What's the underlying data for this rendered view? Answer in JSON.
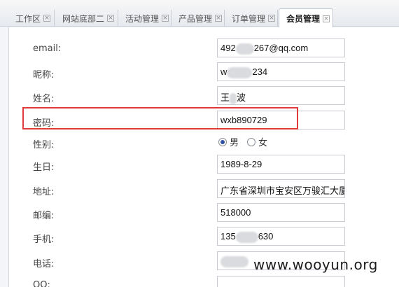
{
  "tabs": [
    {
      "label": "工作区"
    },
    {
      "label": "网站底部二"
    },
    {
      "label": "活动管理"
    },
    {
      "label": "产品管理"
    },
    {
      "label": "订单管理"
    },
    {
      "label": "会员管理"
    }
  ],
  "form": {
    "email_label": "email:",
    "email_prefix": "492",
    "email_suffix": "267@qq.com",
    "nickname_label": "昵称:",
    "nickname_prefix": "w",
    "nickname_suffix": "234",
    "name_label": "姓名:",
    "name_prefix": "王",
    "name_suffix": "波",
    "password_label": "密码:",
    "password_value": "wxb890729",
    "gender_label": "性别:",
    "gender_male": "男",
    "gender_female": "女",
    "gender_selected": "男",
    "birthday_label": "生日:",
    "birthday_value": "1989-8-29",
    "address_label": "地址:",
    "address_value": "广东省深圳市宝安区万骏汇大厦首",
    "zip_label": "邮编:",
    "zip_value": "518000",
    "mobile_label": "手机:",
    "mobile_prefix": "135",
    "mobile_suffix": "630",
    "phone_label": "电话:",
    "qq_label": "QQ:"
  },
  "watermark": "www.wooyun.org",
  "colors": {
    "highlight_border": "#e03a3a",
    "radio_selected": "#2f4fa0"
  }
}
